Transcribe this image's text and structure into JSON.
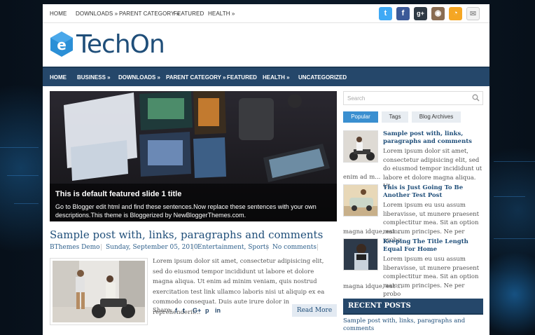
{
  "top_nav": {
    "items": [
      "HOME",
      "DOWNLOADS »",
      "PARENT CATEGORY »",
      "FEATURED",
      "HEALTH »"
    ],
    "socials": [
      {
        "icon": "twitter-icon",
        "glyph": "t",
        "color": "#3fa9f5"
      },
      {
        "icon": "facebook-icon",
        "glyph": "f",
        "color": "#3b5998"
      },
      {
        "icon": "google-plus-icon",
        "glyph": "g+",
        "color": "#2f3a45"
      },
      {
        "icon": "instagram-icon",
        "glyph": "◉",
        "color": "#8a6d52"
      },
      {
        "icon": "rss-icon",
        "glyph": "◔",
        "color": "#f5a623"
      },
      {
        "icon": "email-icon",
        "glyph": "✉",
        "color": "#b8b8b8"
      }
    ]
  },
  "logo": {
    "text": "TechOn"
  },
  "main_nav": {
    "items": [
      "HOME",
      "BUSINESS »",
      "DOWNLOADS »",
      "PARENT CATEGORY »",
      "FEATURED",
      "HEALTH »",
      "UNCATEGORIZED"
    ]
  },
  "slider": {
    "title": "This is default featured slide 1 title",
    "description": "Go to Blogger edit html and find these sentences.Now replace these sentences with your own descriptions.This theme is Bloggerized by NewBloggerThemes.com."
  },
  "post": {
    "title": "Sample post with, links, paragraphs and comments",
    "author": "BThemes Demo",
    "date": "Sunday, September 05, 2010",
    "categories": "Entertainment, Sports",
    "comments": "No comments",
    "excerpt": "Lorem ipsum dolor sit amet, consectetur adipisicing elit, sed do eiusmod tempor incididunt ut labore et dolore magna aliqua. Ut enim ad minim veniam, quis nostrud exercitation test link ullamco laboris nisi ut aliquip ex ea commodo consequat. Duis aute irure dolor in reprehenderit...",
    "share_label": "Share:",
    "share_icons": [
      "f",
      "t",
      "G+",
      "p",
      "in"
    ],
    "read_more": "Read More"
  },
  "sidebar": {
    "search_placeholder": "Search",
    "tabs": [
      "Popular",
      "Tags",
      "Blog Archives"
    ],
    "posts": [
      {
        "title": "Sample post with, links, paragraphs and comments",
        "text": "Lorem ipsum dolor sit amet, consectetur adipisicing elit, sed do eiusmod tempor incididunt ut labore et dolore magna aliqua. Ut",
        "tail": "enim ad m..."
      },
      {
        "title": "This is Just Going To Be Another Test Post",
        "text": "Lorem ipsum eu usu assum liberavisse, ut munere praesent complectitur mea. Sit an option maiorum principes. Ne per probo",
        "tail": "magna idque, est ..."
      },
      {
        "title": "Keeping The Title Length Equal For Home",
        "text": "Lorem ipsum eu usu assum liberavisse, ut munere praesent complectitur mea. Sit an option maiorum principes. Ne per probo",
        "tail": "magna idque, est ..."
      }
    ],
    "recent_posts_heading": "RECENT POSTS",
    "recent_posts": [
      "Sample post with, links, paragraphs and comments"
    ]
  },
  "colors": {
    "accent": "#25476a",
    "link": "#1f4e79",
    "tab_active": "#3a8fd0"
  }
}
